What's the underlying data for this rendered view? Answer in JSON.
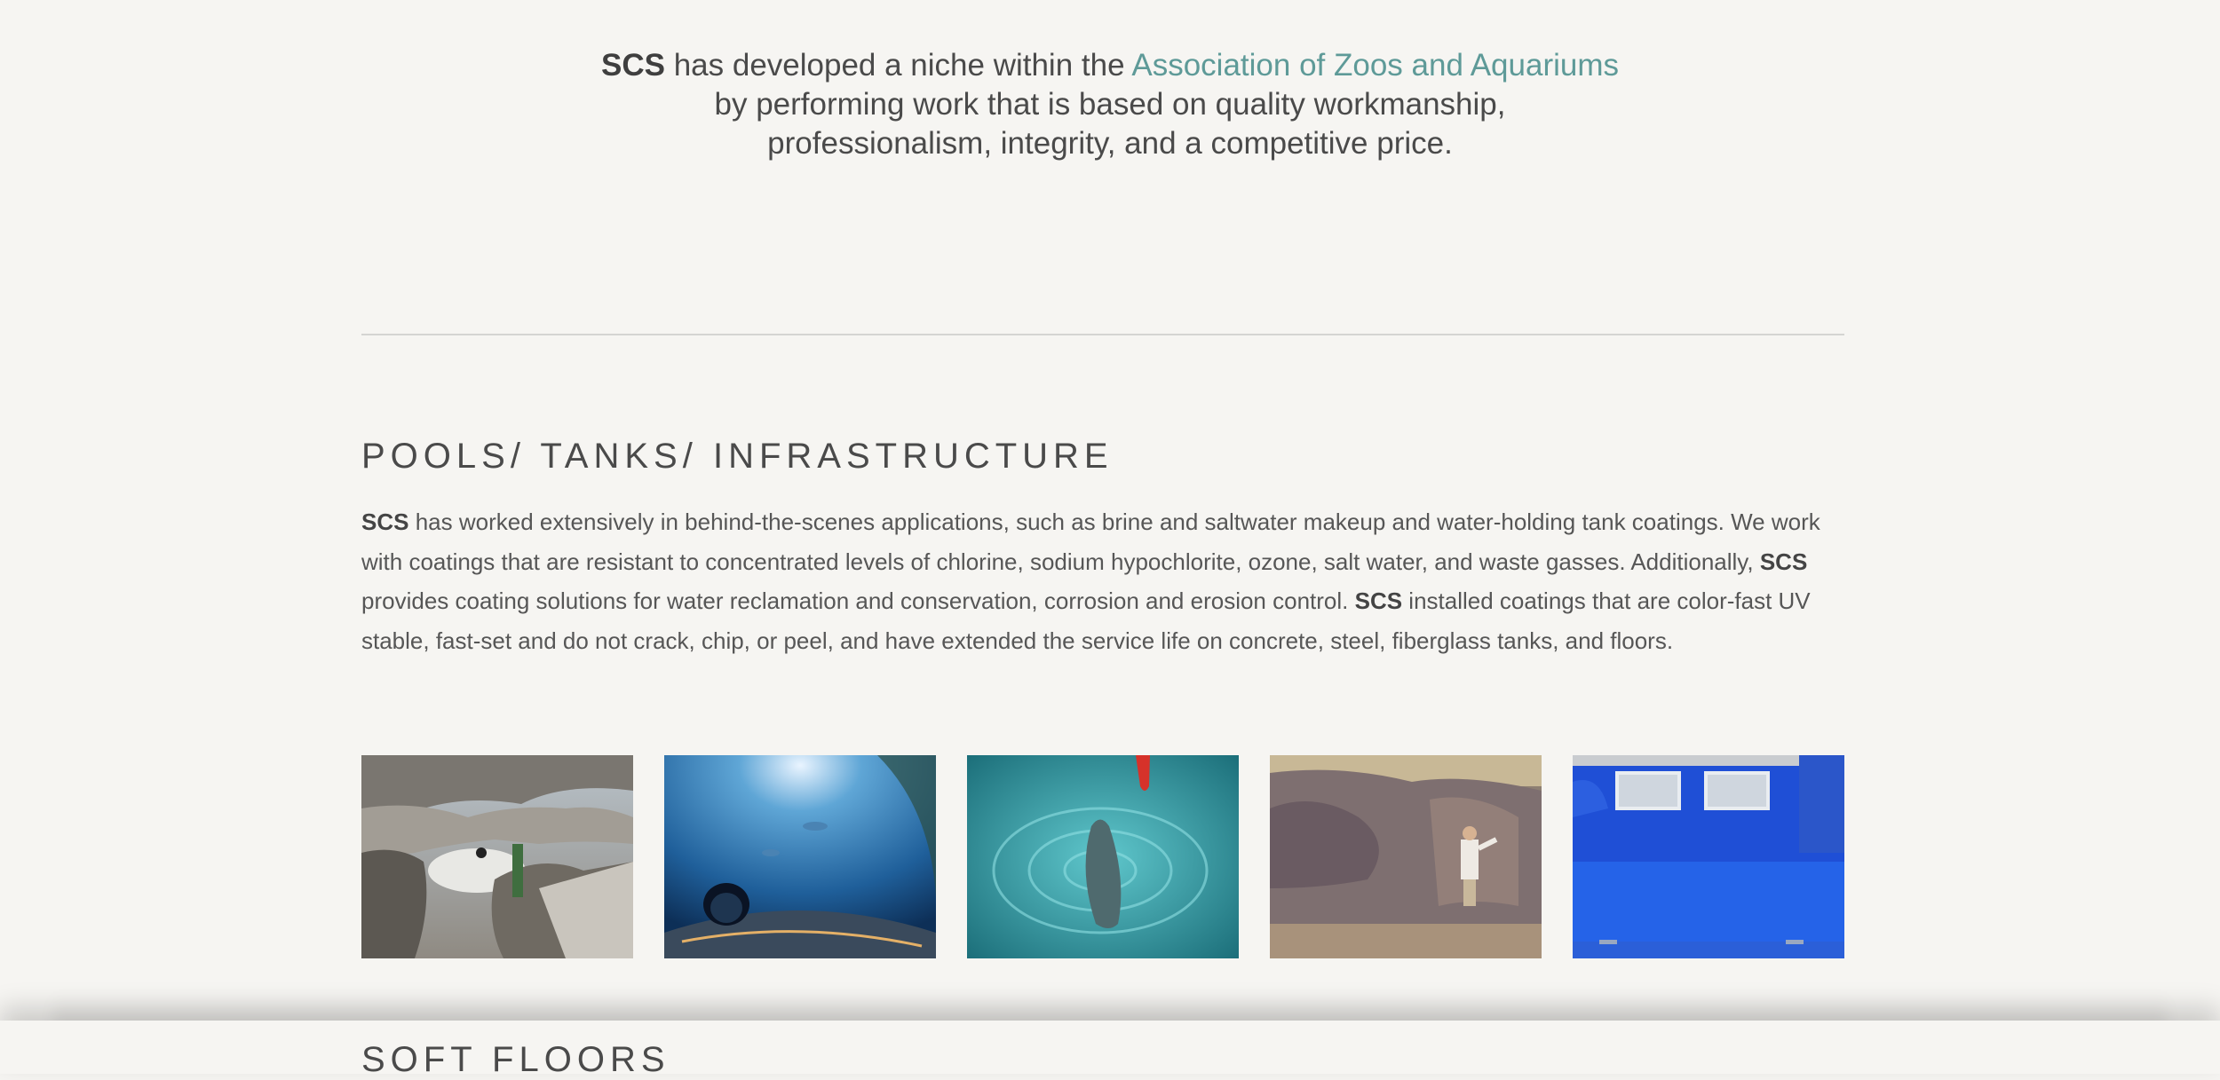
{
  "intro": {
    "brand": "SCS",
    "line1_text": " has developed a niche within the ",
    "link": "Association of Zoos and Aquariums",
    "line2": "by performing work that is based on quality workmanship,",
    "line3": "professionalism, integrity, and a competitive price."
  },
  "section": {
    "title": "POOLS/ TANKS/ INFRASTRUCTURE",
    "brand": "SCS",
    "p1": " has worked extensively in behind-the-scenes applications, such as brine and saltwater makeup and water-holding tank coatings. We work with coatings that are resistant to concentrated levels of chlorine, sodium hypochlorite, ozone, salt water, and waste gasses. Additionally, ",
    "p2": " provides coating solutions for water reclamation and conservation, corrosion and erosion control. ",
    "p3": " installed coatings that are color-fast UV stable, fast-set and do not crack, chip, or peel, and have extended the service life on concrete, steel, fiberglass tanks, and floors."
  },
  "gallery": {
    "images": [
      {
        "name": "rock-arch-photo"
      },
      {
        "name": "aquarium-tunnel-photo"
      },
      {
        "name": "dolphin-pool-photo"
      },
      {
        "name": "worker-rockwork-photo"
      },
      {
        "name": "blue-tank-photo"
      }
    ]
  },
  "next_section": {
    "title": "SOFT FLOORS"
  },
  "colors": {
    "background": "#f6f5f2",
    "link": "#5e9a98",
    "text": "#4d4d4d"
  }
}
